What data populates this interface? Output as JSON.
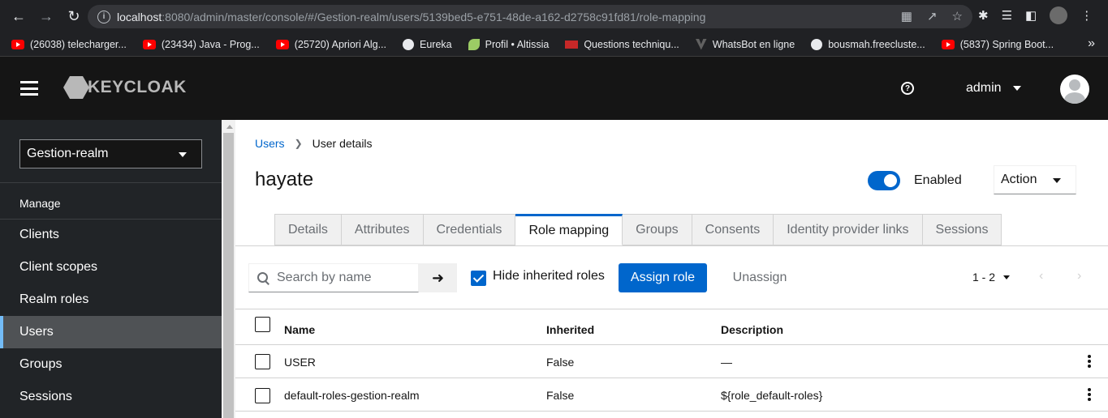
{
  "browser": {
    "url_host": "localhost",
    "url_rest": ":8080/admin/master/console/#/Gestion-realm/users/5139bed5-e751-48de-a162-d2758c91fd81/role-mapping",
    "bookmarks": [
      {
        "label": "(26038) telecharger...",
        "icon": "youtube-icon"
      },
      {
        "label": "(23434) Java - Prog...",
        "icon": "youtube-icon"
      },
      {
        "label": "(25720) Apriori Alg...",
        "icon": "youtube-icon"
      },
      {
        "label": "Eureka",
        "icon": "globe-icon"
      },
      {
        "label": "Profil • Altissia",
        "icon": "leaf-icon"
      },
      {
        "label": "Questions techniqu...",
        "icon": "flag-icon"
      },
      {
        "label": "WhatsBot en ligne",
        "icon": "whatsbot-icon"
      },
      {
        "label": "bousmah.freecluste...",
        "icon": "globe-icon"
      },
      {
        "label": "(5837) Spring Boot...",
        "icon": "youtube-icon"
      }
    ]
  },
  "header": {
    "logo_text": "KEYCLOAK",
    "username": "admin"
  },
  "sidebar": {
    "realm": "Gestion-realm",
    "section": "Manage",
    "items": [
      {
        "label": "Clients"
      },
      {
        "label": "Client scopes"
      },
      {
        "label": "Realm roles"
      },
      {
        "label": "Users"
      },
      {
        "label": "Groups"
      },
      {
        "label": "Sessions"
      }
    ]
  },
  "main": {
    "breadcrumb": {
      "link": "Users",
      "current": "User details"
    },
    "title": "hayate",
    "enabled_label": "Enabled",
    "action_label": "Action",
    "tabs": [
      {
        "label": "Details"
      },
      {
        "label": "Attributes"
      },
      {
        "label": "Credentials"
      },
      {
        "label": "Role mapping"
      },
      {
        "label": "Groups"
      },
      {
        "label": "Consents"
      },
      {
        "label": "Identity provider links"
      },
      {
        "label": "Sessions"
      }
    ],
    "search_placeholder": "Search by name",
    "hide_inherited_label": "Hide inherited roles",
    "assign_label": "Assign role",
    "unassign_label": "Unassign",
    "pagination": "1 - 2",
    "table": {
      "columns": [
        "Name",
        "Inherited",
        "Description"
      ],
      "rows": [
        [
          "USER",
          "False",
          "—"
        ],
        [
          "default-roles-gestion-realm",
          "False",
          "${role_default-roles}"
        ]
      ]
    }
  },
  "colors": {
    "primary": "#0066cc",
    "masthead": "#151515",
    "sidebar": "#212427",
    "active_nav": "#4f5255"
  }
}
